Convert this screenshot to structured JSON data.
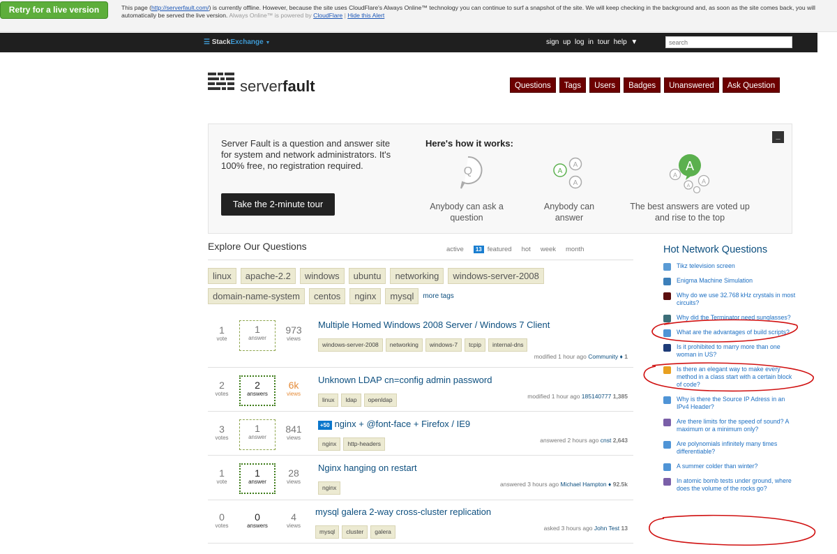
{
  "alert": {
    "retry_label": "Retry for a live version",
    "text_before": "This page (",
    "page_link": "http://serverfault.com/",
    "text_after": ") is currently offline. However, because the site uses CloudFlare's Always Online™ technology you can continue to surf a snapshot of the site. We will keep checking in the background and, as soon as the site comes back, you will automatically be served the live version.",
    "powered_text": "Always Online™ is powered by",
    "cloudflare_link": "CloudFlare",
    "separator": "|",
    "hide_link": "Hide this Alert"
  },
  "se_bar": {
    "logo_stack": "Stack",
    "logo_exchange": "Exchange",
    "dropdown_glyph": "▼",
    "nav": [
      "sign up",
      "log in",
      "tour",
      "help ▼"
    ],
    "search_placeholder": "search"
  },
  "site": {
    "logo_plain": "server",
    "logo_bold": "fault"
  },
  "topnav": [
    "Questions",
    "Tags",
    "Users",
    "Badges",
    "Unanswered",
    "Ask Question"
  ],
  "welcome": {
    "intro": "Server Fault is a question and answer site for system and network administrators. It's 100% free, no registration required.",
    "tour_button": "Take the 2-minute tour",
    "how_title": "Here's how it works:",
    "minimize_glyph": "_",
    "step1": "Anybody can ask a question",
    "step2": "Anybody can answer",
    "step3": "The best answers are voted up and rise to the top",
    "icon_q_letter": "Q",
    "icon_a_letter": "A"
  },
  "explore": {
    "title": "Explore Our Questions",
    "tabs": [
      "active",
      "featured",
      "hot",
      "week",
      "month"
    ],
    "featured_count": "13",
    "tags_row1": [
      "linux",
      "apache-2.2",
      "windows",
      "ubuntu",
      "networking",
      "windows-server-2008"
    ],
    "tags_row2": [
      "domain-name-system",
      "centos",
      "nginx",
      "mysql"
    ],
    "more_tags": "more tags"
  },
  "questions": [
    {
      "votes": "1",
      "votes_label": "vote",
      "answers": "1",
      "answers_label": "answer",
      "views": "973",
      "views_label": "views",
      "title": "Multiple Homed Windows 2008 Server / Windows 7 Client",
      "tags": [
        "windows-server-2008",
        "networking",
        "windows-7",
        "tcpip",
        "internal-dns"
      ],
      "meta_action": "modified 1 hour ago",
      "meta_user": "Community ♦",
      "meta_rep": "1"
    },
    {
      "votes": "2",
      "votes_label": "votes",
      "answers": "2",
      "answers_label": "answers",
      "views": "6k",
      "views_label": "views",
      "title": "Unknown LDAP cn=config admin password",
      "tags": [
        "linux",
        "ldap",
        "openldap"
      ],
      "meta_action": "modified 1 hour ago",
      "meta_user": "185140777",
      "meta_rep": "1,385"
    },
    {
      "votes": "3",
      "votes_label": "votes",
      "answers": "1",
      "answers_label": "answer",
      "views": "841",
      "views_label": "views",
      "bounty": "+50",
      "title": "nginx + @font-face + Firefox / IE9",
      "tags": [
        "nginx",
        "http-headers"
      ],
      "meta_action": "answered 2 hours ago",
      "meta_user": "cnst",
      "meta_rep": "2,643"
    },
    {
      "votes": "1",
      "votes_label": "vote",
      "answers": "1",
      "answers_label": "answer",
      "views": "28",
      "views_label": "views",
      "title": "Nginx hanging on restart",
      "tags": [
        "nginx"
      ],
      "meta_action": "answered 3 hours ago",
      "meta_user": "Michael Hampton ♦",
      "meta_rep": "92.5k"
    },
    {
      "votes": "0",
      "votes_label": "votes",
      "answers": "0",
      "answers_label": "answers",
      "views": "4",
      "views_label": "views",
      "title": "mysql galera 2-way cross-cluster replication",
      "tags": [
        "mysql",
        "cluster",
        "galera"
      ],
      "meta_action": "asked 3 hours ago",
      "meta_user": "John Test",
      "meta_rep": "13"
    }
  ],
  "hot_network": {
    "title": "Hot Network Questions",
    "items": [
      {
        "text": "Tikz television screen",
        "color": "#5a9bd5",
        "icon": "tex-icon"
      },
      {
        "text": "Enigma Machine Simulation",
        "color": "#3c7fb9",
        "icon": "codegolf-icon"
      },
      {
        "text": "Why do we use 32.768 kHz crystals in most circuits?",
        "color": "#5b0e0e",
        "icon": "electronics-icon"
      },
      {
        "text": "Why did the Terminator need sunglasses?",
        "color": "#3c6e78",
        "icon": "movies-icon"
      },
      {
        "text": "What are the advantages of build scripts?",
        "color": "#4f94d6",
        "icon": "programmers-icon"
      },
      {
        "text": "Is it prohibited to marry more than one woman in US?",
        "color": "#1e3c78",
        "icon": "law-icon"
      },
      {
        "text": "Is there an elegant way to make every method in a class start with a certain block of code?",
        "color": "#e8a020",
        "icon": "stackoverflow-icon"
      },
      {
        "text": "Why is there the Source IP Adress in an IPv4 Header?",
        "color": "#4f94d6",
        "icon": "networking-icon"
      },
      {
        "text": "Are there limits for the speed of sound? A maximum or a minimum only?",
        "color": "#7a5fa8",
        "icon": "physics-icon"
      },
      {
        "text": "Are polynomials infinitely many times differentiable?",
        "color": "#4f94d6",
        "icon": "math-icon"
      },
      {
        "text": "A summer colder than winter?",
        "color": "#4f94d6",
        "icon": "worldbuilding-icon"
      },
      {
        "text": "In atomic bomb tests under ground, where does the volume of the rocks go?",
        "color": "#7a5fa8",
        "icon": "physics-icon"
      }
    ]
  },
  "colors": {
    "nav_red": "#6c0000",
    "link": "#0d4f7f",
    "retry_green": "#5dae3b",
    "annotation_red": "#d01010"
  }
}
